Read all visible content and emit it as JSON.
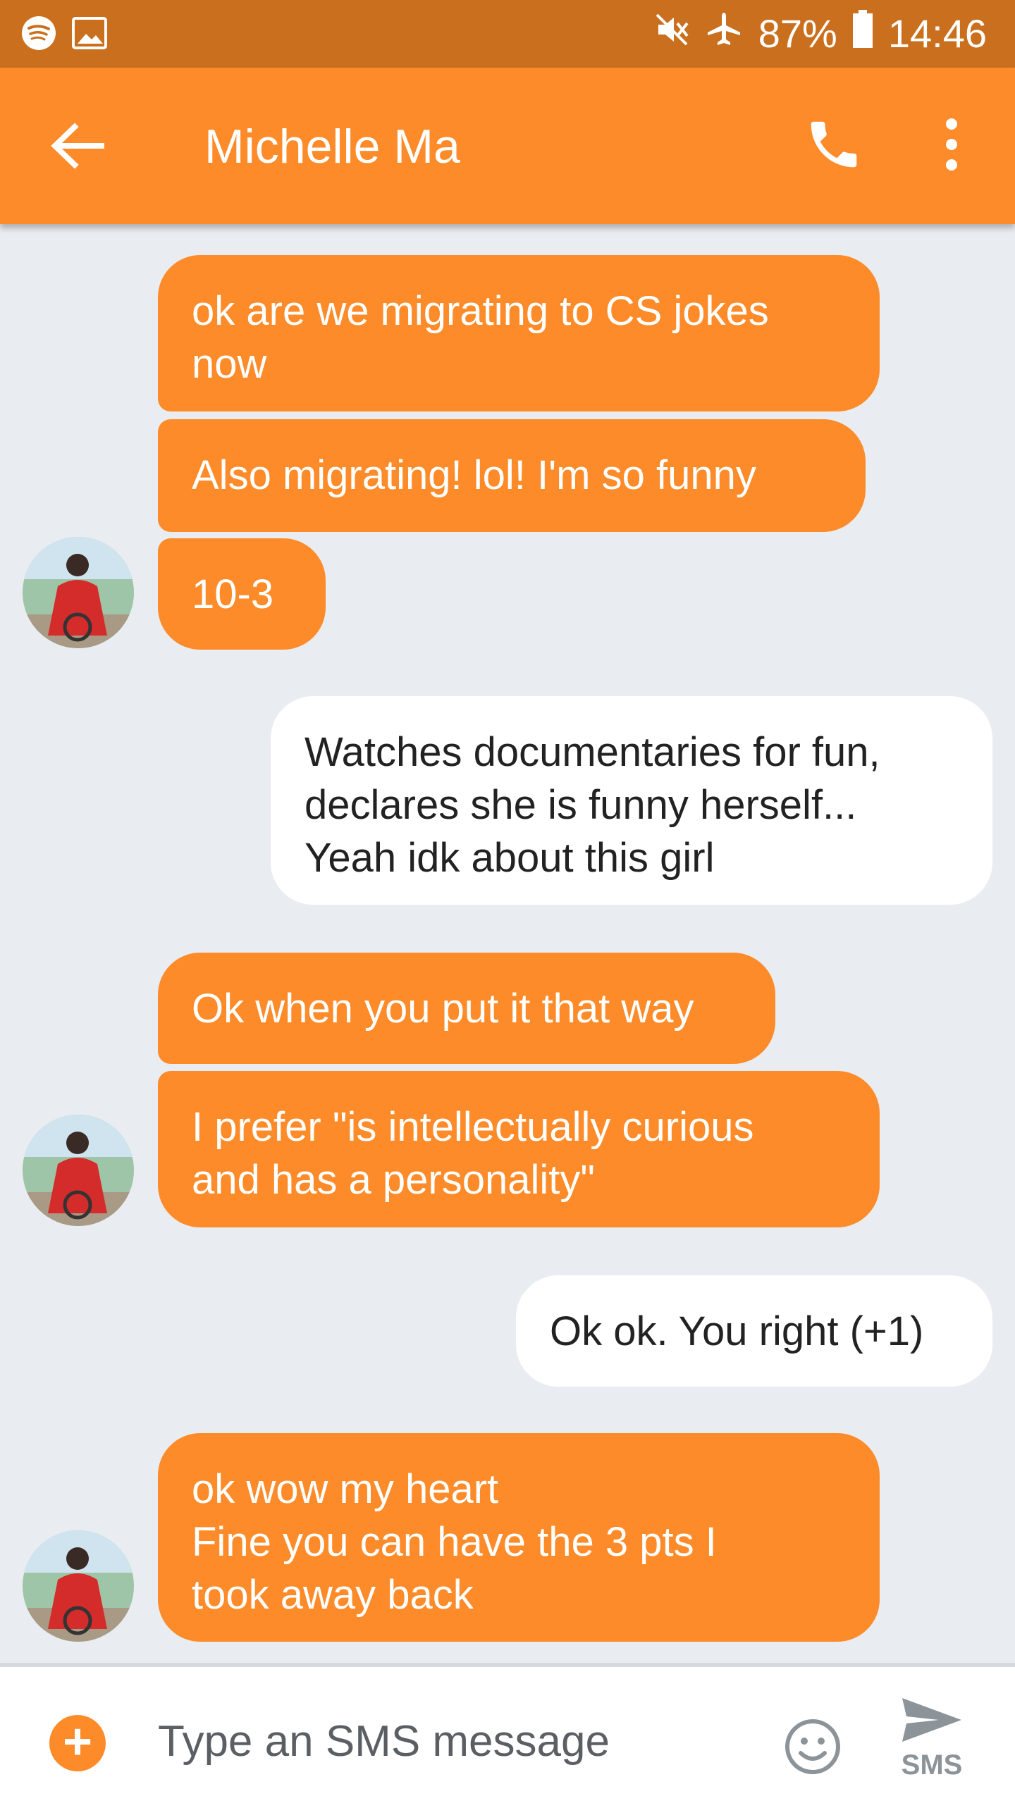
{
  "status_bar": {
    "battery": "87%",
    "time": "14:46",
    "icons": [
      "spotify-icon",
      "image-icon",
      "mute-icon",
      "airplane-icon",
      "battery-icon"
    ]
  },
  "header": {
    "contact_name": "Michelle Ma",
    "icons": [
      "back-arrow-icon",
      "phone-icon",
      "more-vert-icon"
    ]
  },
  "messages": [
    {
      "direction": "incoming",
      "text": "ok are we migrating to CS jokes\nnow"
    },
    {
      "direction": "incoming",
      "text": "Also migrating! lol! I'm so funny"
    },
    {
      "direction": "incoming",
      "text": "10-3"
    },
    {
      "direction": "outgoing",
      "text": "Watches documentaries for fun,\ndeclares she is funny herself...\nYeah idk about this girl"
    },
    {
      "direction": "incoming",
      "text": "Ok when you put it that way"
    },
    {
      "direction": "incoming",
      "text": "I prefer \"is intellectually curious\nand has a personality\""
    },
    {
      "direction": "outgoing",
      "text": "Ok ok. You right (+1)"
    },
    {
      "direction": "incoming",
      "text": "ok wow my heart\nFine you can have the 3 pts I\ntook away back"
    }
  ],
  "composer": {
    "placeholder": "Type an SMS message",
    "send_label": "SMS"
  },
  "colors": {
    "status_bar": "#c96f1e",
    "accent": "#fd8b29",
    "background": "#e9ecf0",
    "outgoing_bubble": "#ffffff",
    "send_icon": "#8c9399"
  }
}
